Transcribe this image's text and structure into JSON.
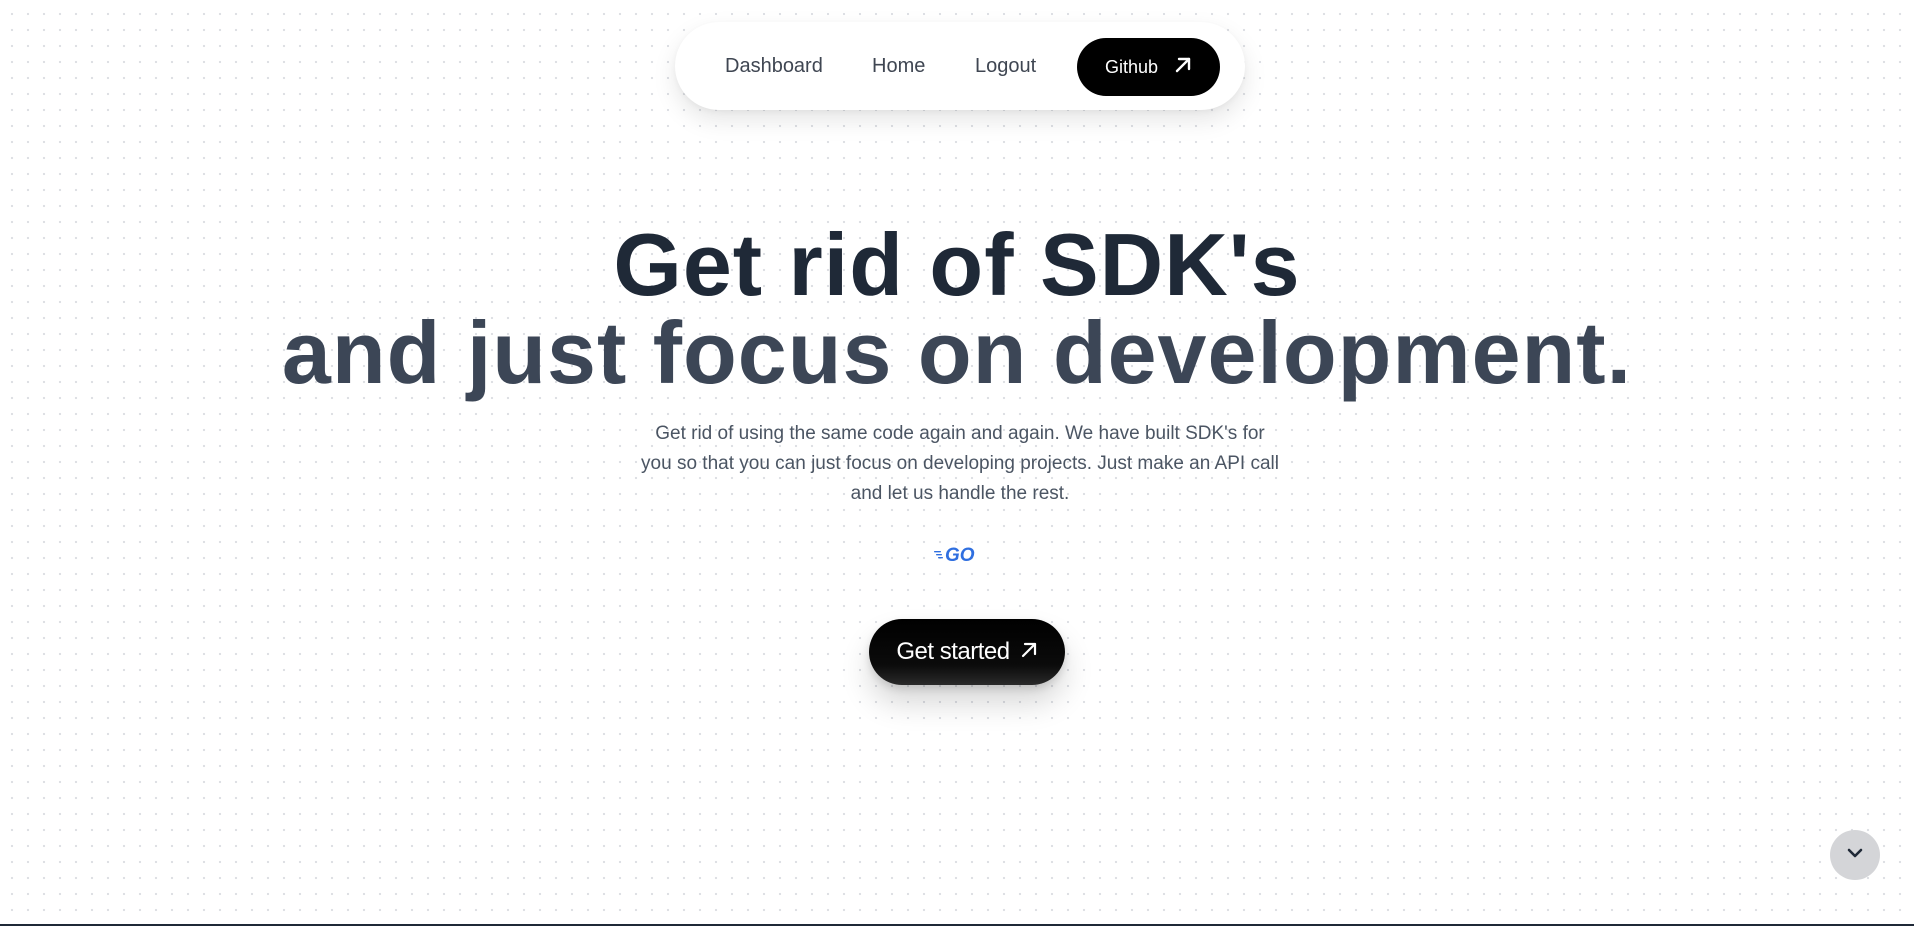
{
  "nav": {
    "links": [
      "Dashboard",
      "Home",
      "Logout"
    ],
    "github_label": "Github",
    "github_icon": "arrow-up-right-icon"
  },
  "hero": {
    "title_line1": "Get rid of SDK's",
    "title_line2": "and just focus on development.",
    "description": "Get rid of using the same code again and again. We have built SDK's for you so that you can just focus on developing projects. Just make an API call and let us handle the rest.",
    "logo": "GO",
    "cta_label": "Get started",
    "cta_icon": "arrow-up-right-icon"
  },
  "scroll_button": {
    "icon": "chevron-down-icon"
  },
  "colors": {
    "heading_primary": "#1f2937",
    "heading_secondary": "#3c4656",
    "go_blue": "#2f6fe0",
    "button_black": "#000000"
  }
}
